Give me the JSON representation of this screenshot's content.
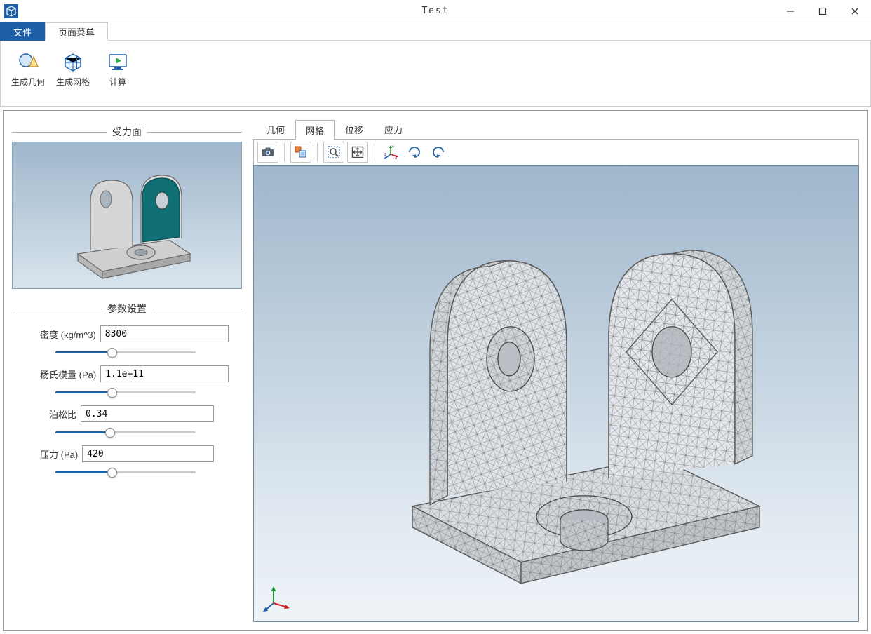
{
  "window": {
    "title": "Test"
  },
  "tabs": {
    "file": "文件",
    "page": "页面菜单"
  },
  "ribbon": {
    "gen_geometry": "生成几何",
    "gen_mesh": "生成网格",
    "compute": "计算"
  },
  "left": {
    "force_face_title": "受力面",
    "param_title": "参数设置",
    "density": {
      "label": "密度 (kg/m^3)",
      "value": "8300"
    },
    "youngs": {
      "label": "杨氏模量 (Pa)",
      "value": "1.1e+11"
    },
    "poisson": {
      "label": "泊松比",
      "value": "0.34"
    },
    "pressure": {
      "label": "压力 (Pa)",
      "value": "420"
    }
  },
  "view_tabs": {
    "geometry": "几何",
    "mesh": "网格",
    "displacement": "位移",
    "stress": "应力"
  },
  "toolbar_icons": {
    "screenshot": "camera-icon",
    "selection_mode": "selection-mode-icon",
    "zoom_box": "zoom-box-icon",
    "zoom_extents": "zoom-extents-icon",
    "axes": "axes-icon",
    "rotate_ccw": "rotate-ccw-icon",
    "rotate_cw": "rotate-cw-icon"
  },
  "gizmo": {
    "x": "x",
    "y": "y",
    "z": "z"
  }
}
